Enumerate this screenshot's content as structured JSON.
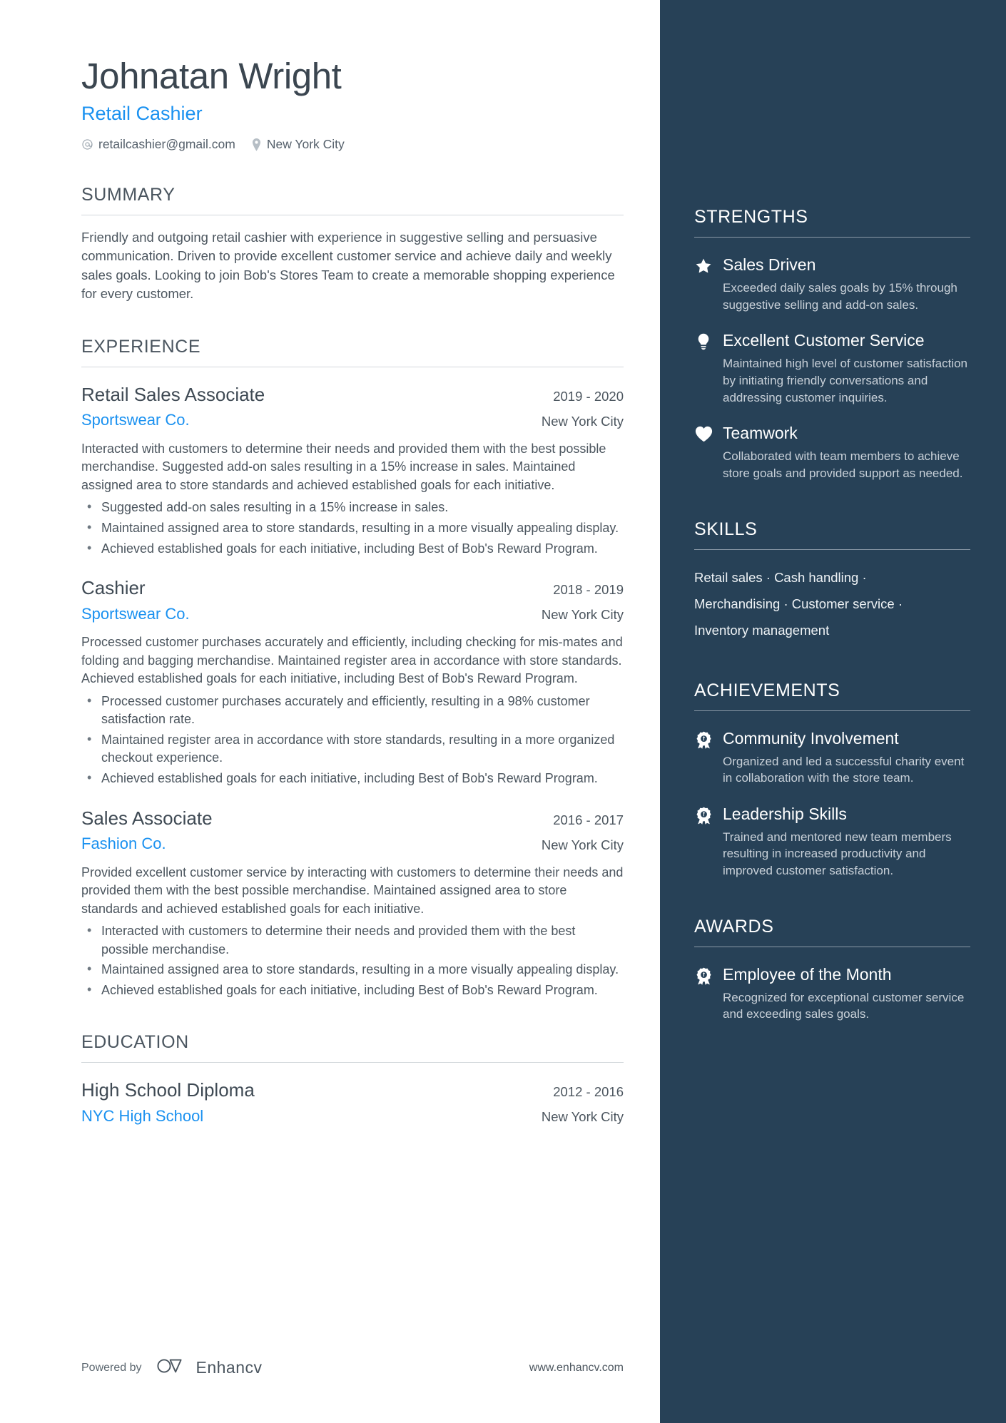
{
  "header": {
    "name": "Johnatan Wright",
    "job_title": "Retail Cashier",
    "email": "retailcashier@gmail.com",
    "location": "New York City",
    "email_icon": "at-sign-icon",
    "location_icon": "map-pin-icon"
  },
  "summary": {
    "title": "SUMMARY",
    "text": "Friendly and outgoing retail cashier with experience in suggestive selling and persuasive communication. Driven to provide excellent customer service and achieve daily and weekly sales goals. Looking to join Bob's Stores Team to create a memorable shopping experience for every customer."
  },
  "experience": {
    "title": "EXPERIENCE",
    "jobs": [
      {
        "role": "Retail Sales Associate",
        "company": "Sportswear Co.",
        "dates": "2019 - 2020",
        "location": "New York City",
        "description": "Interacted with customers to determine their needs and provided them with the best possible merchandise. Suggested add-on sales resulting in a 15% increase in sales. Maintained assigned area to store standards and achieved established goals for each initiative.",
        "bullets": [
          "Suggested add-on sales resulting in a 15% increase in sales.",
          "Maintained assigned area to store standards, resulting in a more visually appealing display.",
          "Achieved established goals for each initiative, including Best of Bob's Reward Program."
        ]
      },
      {
        "role": "Cashier",
        "company": "Sportswear Co.",
        "dates": "2018 - 2019",
        "location": "New York City",
        "description": "Processed customer purchases accurately and efficiently, including checking for mis-mates and folding and bagging merchandise. Maintained register area in accordance with store standards. Achieved established goals for each initiative, including Best of Bob's Reward Program.",
        "bullets": [
          "Processed customer purchases accurately and efficiently, resulting in a 98% customer satisfaction rate.",
          "Maintained register area in accordance with store standards, resulting in a more organized checkout experience.",
          "Achieved established goals for each initiative, including Best of Bob's Reward Program."
        ]
      },
      {
        "role": "Sales Associate",
        "company": "Fashion Co.",
        "dates": "2016 - 2017",
        "location": "New York City",
        "description": "Provided excellent customer service by interacting with customers to determine their needs and provided them with the best possible merchandise. Maintained assigned area to store standards and achieved established goals for each initiative.",
        "bullets": [
          "Interacted with customers to determine their needs and provided them with the best possible merchandise.",
          "Maintained assigned area to store standards, resulting in a more visually appealing display.",
          "Achieved established goals for each initiative, including Best of Bob's Reward Program."
        ]
      }
    ]
  },
  "education": {
    "title": "EDUCATION",
    "entries": [
      {
        "degree": "High School Diploma",
        "school": "NYC High School",
        "dates": "2012 - 2016",
        "location": "New York City"
      }
    ]
  },
  "footer": {
    "powered_by": "Powered by",
    "brand": "Enhancv",
    "url": "www.enhancv.com",
    "brand_icon": "enhancv-logo-icon"
  },
  "sidebar": {
    "strengths": {
      "title": "STRENGTHS",
      "items": [
        {
          "icon": "star-icon",
          "title": "Sales Driven",
          "desc": "Exceeded daily sales goals by 15% through suggestive selling and add-on sales."
        },
        {
          "icon": "lightbulb-icon",
          "title": "Excellent Customer Service",
          "desc": "Maintained high level of customer satisfaction by initiating friendly conversations and addressing customer inquiries."
        },
        {
          "icon": "heart-icon",
          "title": "Teamwork",
          "desc": "Collaborated with team members to achieve store goals and provided support as needed."
        }
      ]
    },
    "skills": {
      "title": "SKILLS",
      "lines": [
        "Retail sales · Cash handling ·",
        "Merchandising · Customer service ·",
        "Inventory management"
      ]
    },
    "achievements": {
      "title": "ACHIEVEMENTS",
      "items": [
        {
          "icon": "award-ribbon-icon",
          "title": "Community Involvement",
          "desc": "Organized and led a successful charity event in collaboration with the store team."
        },
        {
          "icon": "award-ribbon-icon",
          "title": "Leadership Skills",
          "desc": "Trained and mentored new team members resulting in increased productivity and improved customer satisfaction."
        }
      ]
    },
    "awards": {
      "title": "AWARDS",
      "items": [
        {
          "icon": "award-ribbon-icon",
          "title": "Employee of the Month",
          "desc": "Recognized for exceptional customer service and exceeding sales goals."
        }
      ]
    }
  },
  "colors": {
    "sidebar_bg": "#274157",
    "accent_blue": "#1a91f0",
    "heading_gray": "#4a555f",
    "body_gray": "#4c565f"
  }
}
